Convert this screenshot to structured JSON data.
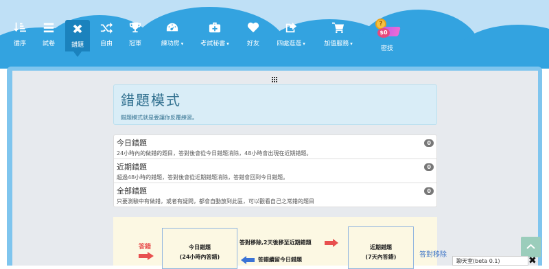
{
  "nav": {
    "items": [
      {
        "label": "循序",
        "icon": "sort-desc-icon"
      },
      {
        "label": "試卷",
        "icon": "list-icon"
      },
      {
        "label": "錯題",
        "icon": "close-icon"
      },
      {
        "label": "自由",
        "icon": "shuffle-icon"
      },
      {
        "label": "冠軍",
        "icon": "trophy-icon"
      },
      {
        "label": "練功房",
        "icon": "dashboard-icon",
        "caret": "▾"
      },
      {
        "label": "考試秘書",
        "icon": "medkit-icon",
        "caret": "▾"
      },
      {
        "label": "好友",
        "icon": "heart-icon"
      },
      {
        "label": "四處逛逛",
        "icon": "share-icon",
        "caret": "▾"
      },
      {
        "label": "加值服務",
        "icon": "cart-icon",
        "caret": "▾"
      },
      {
        "label": "密技",
        "icon": "magic-icon",
        "coin": "$0"
      }
    ],
    "active_index": 2
  },
  "panel": {
    "title": "錯題模式",
    "subtitle": "錯題模式就是要讓你反覆練習。"
  },
  "categories": [
    {
      "name": "今日錯題",
      "desc": "24小時內的做錯的題目，答對後會從今日錯題消除，48小時會出現在近期錯題。",
      "count": "0"
    },
    {
      "name": "近期錯題",
      "desc": "超過48小時的錯題，答對後會從近期錯題消除，答錯會回到今日錯題。",
      "count": "0"
    },
    {
      "name": "全部錯題",
      "desc": "只要測驗中有做錯，或者有疑問，都會自動放到此區，可以觀看自己之常錯的題目",
      "count": "0"
    }
  ],
  "diagram": {
    "wrong_label": "答錯",
    "today_box_title": "今日錯題",
    "today_box_sub": "(24小時內答錯)",
    "move_text": "答對移除,2天後移至近期錯題",
    "stay_text": "答錯續留今日錯題",
    "recent_box_title": "近期錯題",
    "recent_box_sub": "(7天內答錯)",
    "remove_link": "答對移除"
  },
  "footer": {
    "chat_label": "聊天室(beta 0.1)",
    "close_symbol": "✖"
  },
  "colors": {
    "header_blue": "#33a3e0",
    "active_blue": "#1b82bd",
    "info_bg": "#d9edf7",
    "info_text": "#31708f",
    "red_accent": "#e8504f"
  }
}
